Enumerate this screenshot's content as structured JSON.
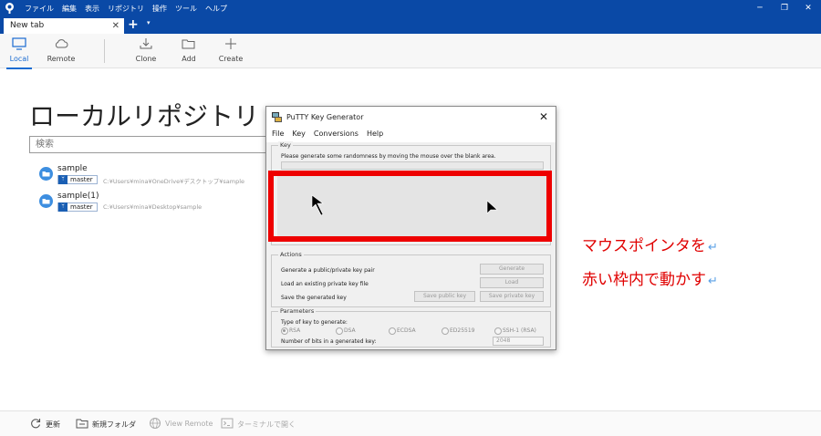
{
  "app": {
    "menu": [
      "ファイル",
      "編集",
      "表示",
      "リポジトリ",
      "操作",
      "ツール",
      "ヘルプ"
    ],
    "window_controls": [
      "minimize-icon",
      "restore-icon",
      "close-icon"
    ]
  },
  "tabs": {
    "active_label": "New tab",
    "add_symbol": "+",
    "dropdown_symbol": "▾"
  },
  "toolbar": {
    "local": "Local",
    "remote": "Remote",
    "clone": "Clone",
    "add": "Add",
    "create": "Create"
  },
  "main": {
    "title": "ローカルリポジトリ",
    "search_placeholder": "検索",
    "repos": [
      {
        "name": "sample",
        "branch": "master",
        "path": "C:¥Users¥mina¥OneDrive¥デスクトップ¥sample"
      },
      {
        "name": "sample(1)",
        "branch": "master",
        "path": "C:¥Users¥mina¥Desktop¥sample"
      }
    ]
  },
  "putty": {
    "title": "PuTTY Key Generator",
    "menu": [
      "File",
      "Key",
      "Conversions",
      "Help"
    ],
    "key_group": "Key",
    "key_hint": "Please generate some randomness by moving the mouse over the blank area.",
    "actions_group": "Actions",
    "actions": [
      {
        "label": "Generate a public/private key pair",
        "buttons": [
          "Generate"
        ]
      },
      {
        "label": "Load an existing private key file",
        "buttons": [
          "Load"
        ]
      },
      {
        "label": "Save the generated key",
        "buttons": [
          "Save public key",
          "Save private key"
        ]
      }
    ],
    "params_group": "Parameters",
    "type_label": "Type of key to generate:",
    "key_types": [
      "RSA",
      "DSA",
      "ECDSA",
      "ED25519",
      "SSH-1 (RSA)"
    ],
    "selected_type": "RSA",
    "bits_label": "Number of bits in a generated key:",
    "bits_value": "2048"
  },
  "annotation": {
    "line1": "マウスポインタを",
    "line2": "赤い枠内で動かす",
    "return_mark": "↵",
    "frame_color": "#ee0000"
  },
  "bottom": {
    "refresh": "更新",
    "new_folder": "新規フォルダ",
    "view_remote": "View Remote",
    "open_terminal": "ターミナルで開く"
  },
  "colors": {
    "titlebar": "#0a49a6",
    "accent": "#1a6bd1",
    "annotation": "#e00000"
  }
}
